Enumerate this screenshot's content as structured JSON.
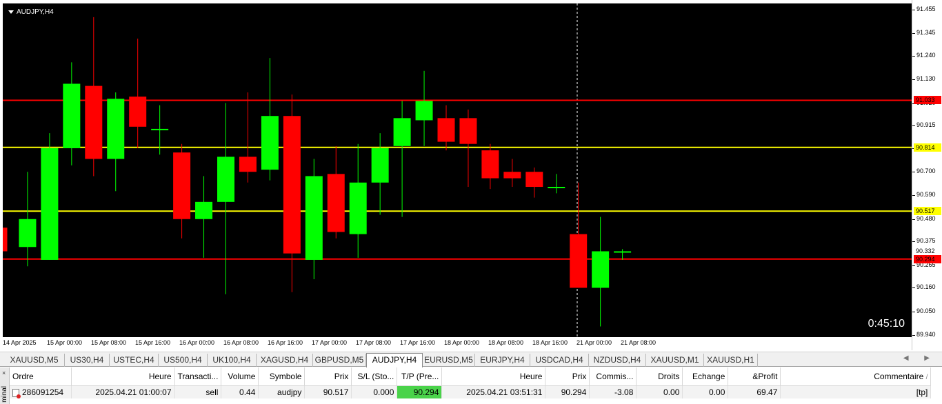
{
  "chart": {
    "symbol_title": "AUDJPY,H4",
    "countdown": "0:45:10",
    "colors": {
      "bull": "#00ff00",
      "bear": "#ff0000",
      "background": "#000000",
      "red_line": "#ff0000",
      "yellow_line": "#ffff00"
    },
    "price_axis": [
      "91.455",
      "91.345",
      "91.240",
      "91.130",
      "91.020",
      "90.915",
      "90.810",
      "90.700",
      "90.590",
      "90.480",
      "90.375",
      "90.265",
      "90.160",
      "90.050",
      "89.940"
    ],
    "price_tags": [
      {
        "label": "91.033",
        "price": 91.033,
        "bg": "#ff0000",
        "fg": "#000000"
      },
      {
        "label": "90.814",
        "price": 90.814,
        "bg": "#ffff00",
        "fg": "#000000"
      },
      {
        "label": "90.517",
        "price": 90.517,
        "bg": "#ffff00",
        "fg": "#000000"
      },
      {
        "label": "90.332",
        "price": 90.332,
        "bg": "#ffffff",
        "fg": "#000000"
      },
      {
        "label": "90.294",
        "price": 90.294,
        "bg": "#ff0000",
        "fg": "#000000"
      }
    ],
    "horizontal_lines": [
      {
        "price": 91.033,
        "color": "#ff0000"
      },
      {
        "price": 90.814,
        "color": "#ffff00"
      },
      {
        "price": 90.517,
        "color": "#ffff00"
      },
      {
        "price": 90.294,
        "color": "#ff0000"
      }
    ],
    "time_axis": [
      "14 Apr 2025",
      "15 Apr 00:00",
      "15 Apr 08:00",
      "15 Apr 16:00",
      "16 Apr 00:00",
      "16 Apr 08:00",
      "16 Apr 16:00",
      "17 Apr 00:00",
      "17 Apr 08:00",
      "17 Apr 16:00",
      "18 Apr 00:00",
      "18 Apr 08:00",
      "18 Apr 16:00",
      "21 Apr 00:00",
      "21 Apr 08:00"
    ]
  },
  "chart_data": {
    "type": "candlestick",
    "title": "AUDJPY,H4",
    "ylim": [
      89.94,
      91.455
    ],
    "candles": [
      {
        "o": 90.44,
        "h": 90.47,
        "l": 90.33,
        "c": 90.33
      },
      {
        "o": 90.35,
        "h": 90.7,
        "l": 90.26,
        "c": 90.48
      },
      {
        "o": 90.29,
        "h": 90.88,
        "l": 90.29,
        "c": 90.81
      },
      {
        "o": 90.81,
        "h": 91.21,
        "l": 90.73,
        "c": 91.11
      },
      {
        "o": 91.1,
        "h": 91.42,
        "l": 90.68,
        "c": 90.76
      },
      {
        "o": 90.76,
        "h": 91.07,
        "l": 90.61,
        "c": 91.04
      },
      {
        "o": 91.05,
        "h": 91.32,
        "l": 90.81,
        "c": 90.91
      },
      {
        "o": 90.9,
        "h": 91.01,
        "l": 90.78,
        "c": 90.9
      },
      {
        "o": 90.79,
        "h": 90.83,
        "l": 90.39,
        "c": 90.48
      },
      {
        "o": 90.48,
        "h": 90.68,
        "l": 90.3,
        "c": 90.56
      },
      {
        "o": 90.56,
        "h": 91.02,
        "l": 90.13,
        "c": 90.77
      },
      {
        "o": 90.77,
        "h": 91.07,
        "l": 90.65,
        "c": 90.7
      },
      {
        "o": 90.71,
        "h": 91.23,
        "l": 90.66,
        "c": 90.96
      },
      {
        "o": 90.96,
        "h": 91.06,
        "l": 90.14,
        "c": 90.32
      },
      {
        "o": 90.29,
        "h": 90.76,
        "l": 90.2,
        "c": 90.68
      },
      {
        "o": 90.69,
        "h": 90.82,
        "l": 90.39,
        "c": 90.42
      },
      {
        "o": 90.41,
        "h": 90.83,
        "l": 90.3,
        "c": 90.65
      },
      {
        "o": 90.65,
        "h": 90.88,
        "l": 90.5,
        "c": 90.81
      },
      {
        "o": 90.82,
        "h": 91.03,
        "l": 90.49,
        "c": 90.95
      },
      {
        "o": 90.94,
        "h": 91.17,
        "l": 90.82,
        "c": 91.03
      },
      {
        "o": 90.95,
        "h": 91.01,
        "l": 90.8,
        "c": 90.84
      },
      {
        "o": 90.95,
        "h": 90.99,
        "l": 90.63,
        "c": 90.83
      },
      {
        "o": 90.8,
        "h": 90.83,
        "l": 90.62,
        "c": 90.67
      },
      {
        "o": 90.7,
        "h": 90.76,
        "l": 90.63,
        "c": 90.67
      },
      {
        "o": 90.7,
        "h": 90.72,
        "l": 90.58,
        "c": 90.63
      },
      {
        "o": 90.63,
        "h": 90.69,
        "l": 90.6,
        "c": 90.63
      },
      {
        "o": 90.41,
        "h": 90.65,
        "l": 90.16,
        "c": 90.16
      },
      {
        "o": 90.16,
        "h": 90.49,
        "l": 89.98,
        "c": 90.33
      },
      {
        "o": 90.33,
        "h": 90.34,
        "l": 90.29,
        "c": 90.33
      }
    ]
  },
  "tabs": {
    "items": [
      "XAUUSD,M5",
      "US30,H4",
      "USTEC,H4",
      "US500,H4",
      "UK100,H4",
      "XAGUSD,H4",
      "GBPUSD,M5",
      "AUDJPY,H4",
      "EURUSD,M5",
      "EURJPY,H4",
      "USDCAD,H4",
      "NZDUSD,H4",
      "XAUUSD,M1",
      "XAUUSD,H1"
    ],
    "active": "AUDJPY,H4",
    "scroll_arrows": "◀ ▶"
  },
  "terminal": {
    "close": "×",
    "side_label": "minal",
    "columns": [
      "Ordre",
      "Heure",
      "Transacti...",
      "Volume",
      "Symbole",
      "Prix",
      "S/L (Sto...",
      "T/P (Pre...",
      "Heure",
      "Prix",
      "Commis...",
      "Droits",
      "Echange",
      "&Profit",
      "Commentaire"
    ],
    "sort_indicator": "/",
    "rows": [
      {
        "order": "286091254",
        "open_time": "2025.04.21 01:00:07",
        "type": "sell",
        "volume": "0.44",
        "symbol": "audjpy",
        "open_price": "90.517",
        "sl": "0.000",
        "tp": "90.294",
        "close_time": "2025.04.21 03:51:31",
        "price": "90.294",
        "commission": "-3.08",
        "swap": "0.00",
        "exchange": "0.00",
        "profit": "69.47",
        "comment": "[tp]"
      }
    ]
  }
}
